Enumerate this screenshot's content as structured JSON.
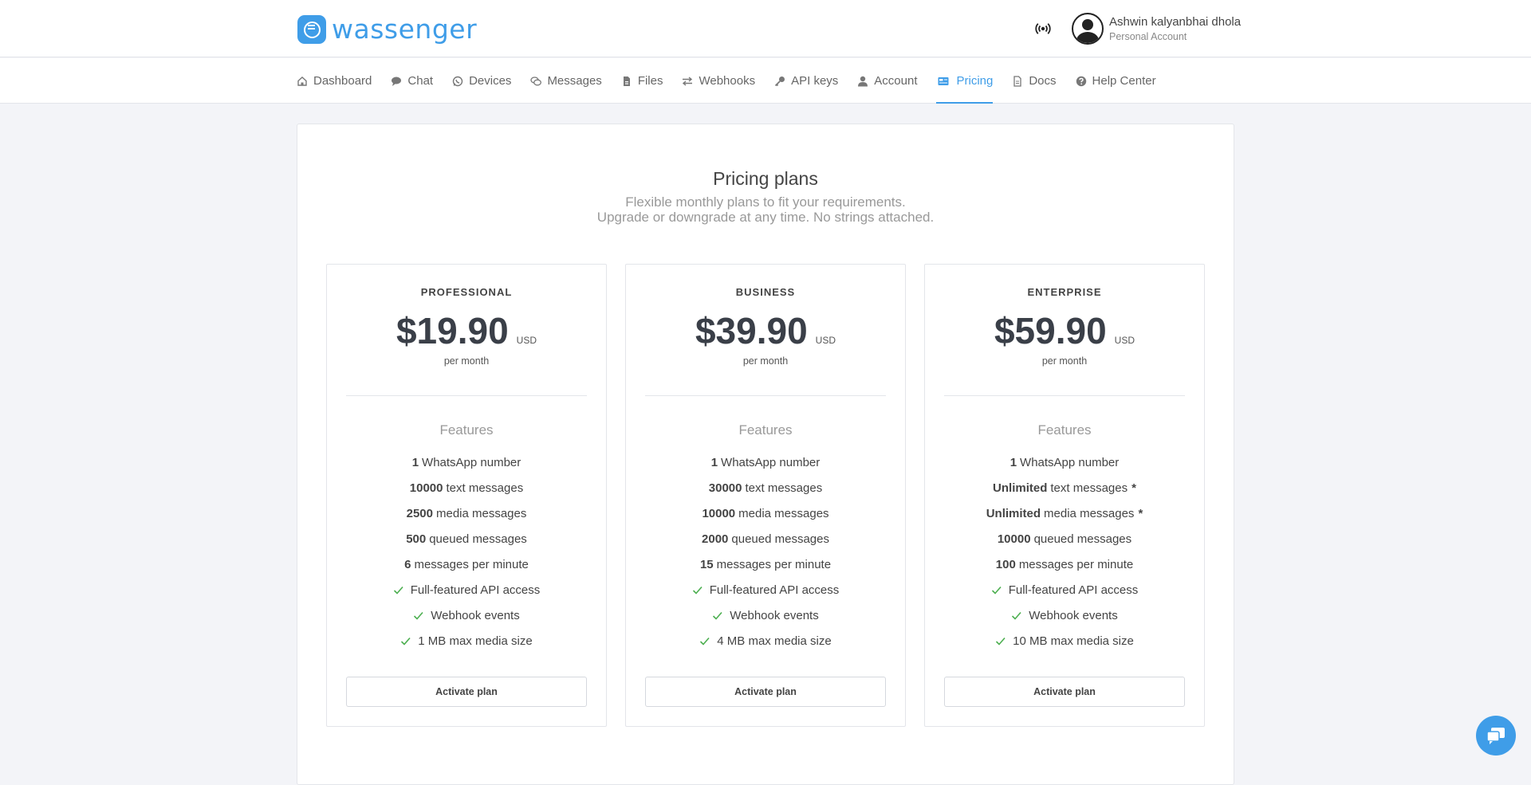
{
  "app": {
    "logo_text": "wassenger"
  },
  "user": {
    "name": "Ashwin kalyanbhai dhola",
    "account_type": "Personal Account"
  },
  "nav": {
    "items": [
      {
        "label": "Dashboard",
        "icon": "home-icon"
      },
      {
        "label": "Chat",
        "icon": "chat-icon"
      },
      {
        "label": "Devices",
        "icon": "whatsapp-icon"
      },
      {
        "label": "Messages",
        "icon": "messages-icon"
      },
      {
        "label": "Files",
        "icon": "file-icon"
      },
      {
        "label": "Webhooks",
        "icon": "exchange-icon"
      },
      {
        "label": "API keys",
        "icon": "key-icon"
      },
      {
        "label": "Account",
        "icon": "user-icon"
      },
      {
        "label": "Pricing",
        "icon": "credit-card-icon",
        "active": true
      },
      {
        "label": "Docs",
        "icon": "document-icon"
      },
      {
        "label": "Help Center",
        "icon": "help-icon"
      }
    ]
  },
  "pricing": {
    "title": "Pricing plans",
    "subtitle_line1": "Flexible monthly plans to fit your requirements.",
    "subtitle_line2": "Upgrade or downgrade at any time. No strings attached.",
    "features_title": "Features",
    "plans": [
      {
        "name": "PROFESSIONAL",
        "price": "$19.90",
        "currency": "USD",
        "period": "per month",
        "features": [
          {
            "bold": "1",
            "text": "WhatsApp number"
          },
          {
            "bold": "10000",
            "text": "text messages"
          },
          {
            "bold": "2500",
            "text": "media messages"
          },
          {
            "bold": "500",
            "text": "queued messages"
          },
          {
            "bold": "6",
            "text": "messages per minute"
          }
        ],
        "checks": [
          "Full-featured API access",
          "Webhook events",
          "1 MB max media size"
        ],
        "button": "Activate plan"
      },
      {
        "name": "BUSINESS",
        "price": "$39.90",
        "currency": "USD",
        "period": "per month",
        "features": [
          {
            "bold": "1",
            "text": "WhatsApp number"
          },
          {
            "bold": "30000",
            "text": "text messages"
          },
          {
            "bold": "10000",
            "text": "media messages"
          },
          {
            "bold": "2000",
            "text": "queued messages"
          },
          {
            "bold": "15",
            "text": "messages per minute"
          }
        ],
        "checks": [
          "Full-featured API access",
          "Webhook events",
          "4 MB max media size"
        ],
        "button": "Activate plan"
      },
      {
        "name": "ENTERPRISE",
        "price": "$59.90",
        "currency": "USD",
        "period": "per month",
        "features": [
          {
            "bold": "1",
            "text": "WhatsApp number"
          },
          {
            "bold": "Unlimited",
            "text": "text messages",
            "star": "*"
          },
          {
            "bold": "Unlimited",
            "text": "media messages",
            "star": "*"
          },
          {
            "bold": "10000",
            "text": "queued messages"
          },
          {
            "bold": "100",
            "text": "messages per minute"
          }
        ],
        "checks": [
          "Full-featured API access",
          "Webhook events",
          "10 MB max media size"
        ],
        "button": "Activate plan"
      }
    ]
  },
  "colors": {
    "accent": "#3f9de8",
    "check": "#4caf50"
  }
}
